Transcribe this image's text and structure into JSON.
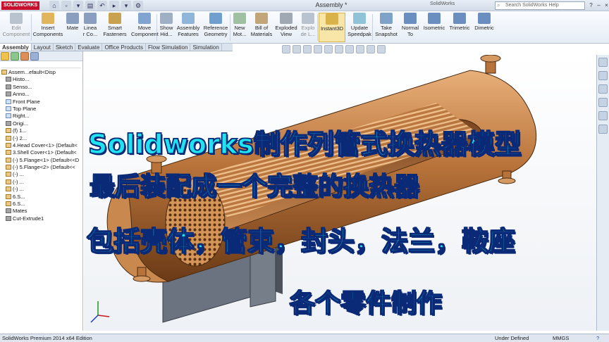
{
  "app": {
    "logo": "SOLIDWORKS",
    "title": "Assembly *",
    "brand_small": "SolidWorks",
    "search_placeholder": "Search SolidWorks Help",
    "quick_access": [
      "⌂",
      "▫",
      "▾",
      "▤",
      "↶",
      "▸",
      "▾",
      "⚙"
    ]
  },
  "ribbon": {
    "buttons": [
      {
        "label1": "Edit",
        "label2": "Component",
        "dim": true
      },
      {
        "label1": "Insert",
        "label2": "Components",
        "dim": false
      },
      {
        "label1": "Mate",
        "label2": "",
        "dim": false
      },
      {
        "label1": "Linea",
        "label2": "r Co...",
        "dim": false
      },
      {
        "label1": "Smart",
        "label2": "Fasteners",
        "dim": false
      },
      {
        "label1": "Move",
        "label2": "Component",
        "dim": false
      },
      {
        "label1": "Show",
        "label2": "Hid...",
        "dim": false
      },
      {
        "label1": "Assembly",
        "label2": "Features",
        "dim": false
      },
      {
        "label1": "Reference",
        "label2": "Geometry",
        "dim": false
      },
      {
        "label1": "New",
        "label2": "Mot...",
        "dim": false
      },
      {
        "label1": "Bill of",
        "label2": "Materials",
        "dim": false
      },
      {
        "label1": "Exploded",
        "label2": "View",
        "dim": false
      },
      {
        "label1": "Explo",
        "label2": "de L...",
        "dim": true
      },
      {
        "label1": "Instant3D",
        "label2": "",
        "dim": false,
        "active": true
      },
      {
        "label1": "Update",
        "label2": "Speedpak",
        "dim": false
      },
      {
        "label1": "Take",
        "label2": "Snapshot",
        "dim": false
      },
      {
        "label1": "Normal",
        "label2": "To",
        "dim": false
      },
      {
        "label1": "Isometric",
        "label2": "",
        "dim": false
      },
      {
        "label1": "Trimetric",
        "label2": "",
        "dim": false
      },
      {
        "label1": "Dimetric",
        "label2": "",
        "dim": false
      }
    ]
  },
  "tabs": [
    "Assembly",
    "Layout",
    "Sketch",
    "Evaluate",
    "Office Products",
    "Flow Simulation",
    "Simulation"
  ],
  "tree": {
    "items": [
      {
        "text": "Assem...efault<Disp",
        "icon": "part",
        "indent": 0
      },
      {
        "text": "Histo...",
        "icon": "feat",
        "indent": 1
      },
      {
        "text": "Senso...",
        "icon": "feat",
        "indent": 1
      },
      {
        "text": "Anno...",
        "icon": "feat",
        "indent": 1
      },
      {
        "text": "Front Plane",
        "icon": "plane",
        "indent": 1
      },
      {
        "text": "Top Plane",
        "icon": "plane",
        "indent": 1
      },
      {
        "text": "Right...",
        "icon": "plane",
        "indent": 1
      },
      {
        "text": "Origi...",
        "icon": "feat",
        "indent": 1
      },
      {
        "text": "(f) 1...",
        "icon": "part",
        "indent": 1
      },
      {
        "text": "(-) 2...",
        "icon": "part",
        "indent": 1
      },
      {
        "text": "4.Head Cover<1> (Default<",
        "icon": "part",
        "indent": 1
      },
      {
        "text": "3.Shell Cover<1> (Default<",
        "icon": "part",
        "indent": 1
      },
      {
        "text": "(-) 5.Flange<1> (Default<<D",
        "icon": "part",
        "indent": 1
      },
      {
        "text": "(-) 5.Flange<2> (Default<<",
        "icon": "part",
        "indent": 1
      },
      {
        "text": "(-) ...",
        "icon": "part",
        "indent": 1
      },
      {
        "text": "(-) ...",
        "icon": "part",
        "indent": 1
      },
      {
        "text": "(-) ...",
        "icon": "part",
        "indent": 1
      },
      {
        "text": "6.S...",
        "icon": "part",
        "indent": 1
      },
      {
        "text": "6.S...",
        "icon": "part",
        "indent": 1
      },
      {
        "text": "Mates",
        "icon": "feat",
        "indent": 1
      },
      {
        "text": "Cut-Extrude1",
        "icon": "feat",
        "indent": 1
      }
    ]
  },
  "caption": {
    "line1": "Solidworks制作列管式换热器模型",
    "line2": "最后装配成一个完整的换热器",
    "line3": "包括壳体，管束，封头，法兰，鞍座",
    "line4": "各个零件制作"
  },
  "status": {
    "left": "SolidWorks Premium 2014 x64 Edition",
    "definition": "Under Defined",
    "units": "MMGS",
    "help": "?"
  },
  "colors": {
    "caption_fill": "#1fe3f0",
    "caption_outline": "#0a2a78",
    "copper": "#b8733a",
    "saddle": "#6b7380"
  }
}
